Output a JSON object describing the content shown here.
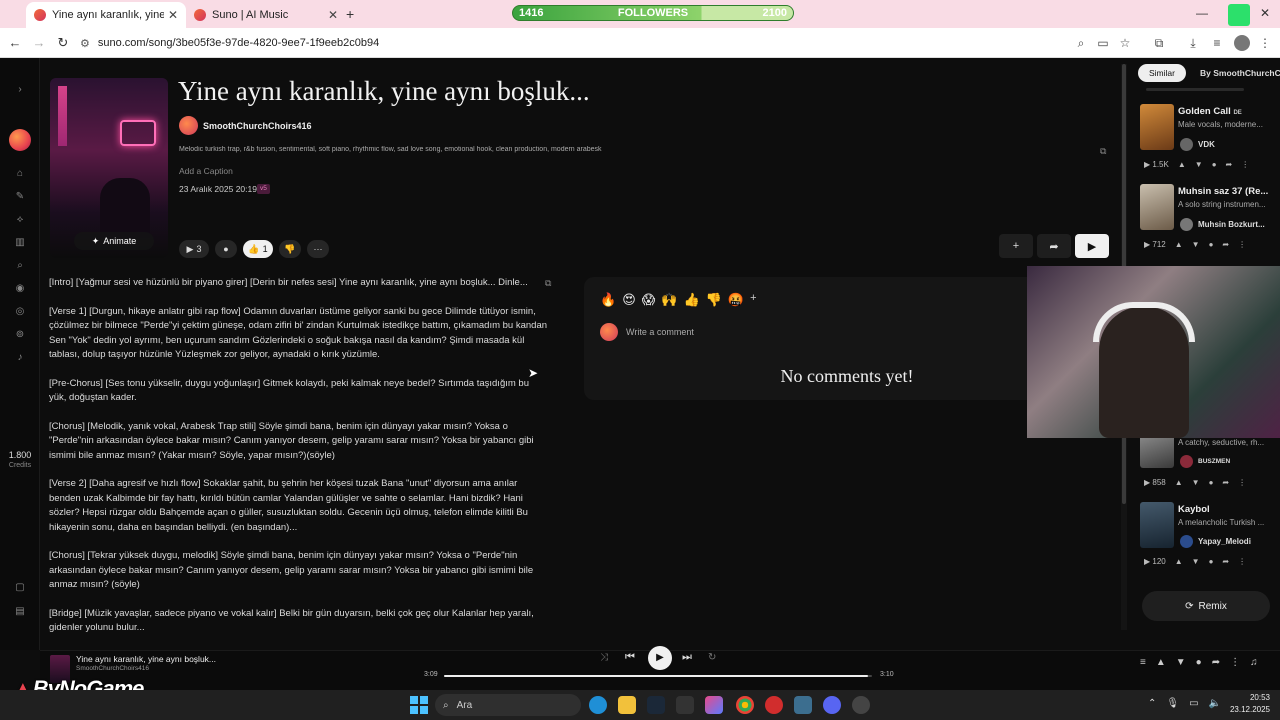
{
  "browser": {
    "tabs": [
      {
        "title": "Yine aynı karanlık, yine aynı boşluk...",
        "close": "✕"
      },
      {
        "title": "Suno | AI Music",
        "close": "✕"
      }
    ],
    "new_tab": "+",
    "url": "suno.com/song/3be05f3e-97de-4820-9ee7-1f9eeb2c0b94",
    "followers_overlay": {
      "current": "1416",
      "label": "FOLLOWERS",
      "goal": "2100",
      "progress": 0.674
    }
  },
  "song": {
    "title": "Yine aynı karanlık, yine aynı boşluk...",
    "artist": "SmoothChurchChoirs416",
    "tags": "Melodic turkish trap, r&b fusion, sentimental, soft piano, rhythmic flow, sad love song, emotional hook, clean production, modern arabesk",
    "caption_placeholder": "Add a Caption",
    "date": "23 Aralık 2025 20:19",
    "version": "v5",
    "animate_label": "Animate",
    "plays": "3",
    "likes": "1",
    "lyrics": [
      "[Intro] [Yağmur sesi ve hüzünlü bir piyano girer] [Derin bir nefes sesi] Yine aynı karanlık, yine aynı boşluk... Dinle...",
      "[Verse 1] [Durgun, hikaye anlatır gibi rap flow] Odamın duvarları üstüme geliyor sanki bu gece Dilimde tütüyor ismin, çözülmez bir bilmece \"Perde\"yi çektim güneşe, odam zifiri bi' zindan Kurtulmak istedikçe battım, çıkamadım bu kandan Sen \"Yok\" dedin yol ayrımı, ben uçurum sandım Gözlerindeki o soğuk bakışa nasıl da kandım? Şimdi masada kül tablası, dolup taşıyor hüzünle Yüzleşmek zor geliyor, aynadaki o kırık yüzümle.",
      "[Pre-Chorus] [Ses tonu yükselir, duygu yoğunlaşır] Gitmek kolaydı, peki kalmak neye bedel? Sırtımda taşıdığım bu yük, doğuştan kader.",
      "[Chorus] [Melodik, yanık vokal, Arabesk Trap stili] Söyle şimdi bana, benim için dünyayı yakar mısın? Yoksa o \"Perde\"nin arkasından öylece bakar mısın? Canım yanıyor desem, gelip yaramı sarar mısın? Yoksa bir yabancı gibi ismimi bile anmaz mısın? (Yakar mısın? Söyle, yapar mısın?)(söyle)",
      "[Verse 2] [Daha agresif ve hızlı flow] Sokaklar şahit, bu şehrin her köşesi tuzak Bana \"unut\" diyorsun ama anılar benden uzak Kalbimde bir fay hattı, kırıldı bütün camlar Yalandan gülüşler ve sahte o selamlar. Hani bizdik? Hani sözler? Hepsi rüzgar oldu Bahçemde açan o güller, susuzluktan soldu. Gecenin üçü olmuş, telefon elimde kilitli Bu hikayenin sonu, daha en başından belliydi. (en başından)...",
      "[Chorus] [Tekrar yüksek duygu, melodik] Söyle şimdi bana, benim için dünyayı yakar mısın? Yoksa o \"Perde\"nin arkasından öylece bakar mısın? Canım yanıyor desem, gelip yaramı sarar mısın? Yoksa bir yabancı gibi ismimi bile anmaz mısın? (söyle)",
      "[Bridge] [Müzik yavaşlar, sadece piyano ve vokal kalır] Belki bir gün duyarsın, belki çok geç olur Kalanlar hep yaralı, gidenler yolunu bulur..."
    ]
  },
  "comments": {
    "emoji_reactions": [
      "🔥",
      "😍",
      "😱",
      "🙌",
      "👍",
      "👎",
      "🤬"
    ],
    "add_reaction": "+",
    "placeholder": "Write a comment",
    "empty_text": "No comments yet!"
  },
  "sidebar": {
    "credits": "1.800",
    "credits_label": "Credits"
  },
  "right_panel": {
    "tabs": [
      "Similar",
      "By SmoothChurchCho"
    ],
    "items": [
      {
        "title": "Golden Call",
        "suffix": "DE",
        "desc": "Male vocals, moderne...",
        "user": "VDK",
        "plays": "1.5K"
      },
      {
        "title": "Muhsin saz 37 (Re...",
        "desc": "A solo string instrumen...",
        "user": "Muhsin Bozkurt...",
        "plays": "712"
      },
      {
        "title": "",
        "desc": "A catchy, seductive, rh...",
        "user": "BUSZMEN",
        "plays": "858"
      },
      {
        "title": "Kaybol",
        "desc": "A melancholic Turkish ...",
        "user": "Yapay_Melodi",
        "plays": "120"
      }
    ],
    "remix_label": "Remix"
  },
  "player": {
    "title": "Yine aynı karanlık, yine aynı boşluk...",
    "artist": "SmoothChurchChoirs416",
    "elapsed": "3:09",
    "duration": "3:10",
    "progress": 0.99
  },
  "taskbar": {
    "search_placeholder": "Ara",
    "time": "20:53",
    "date": "23.12.2025"
  },
  "watermark": "ByNoGame",
  "colors": {
    "accent": "#e8434f",
    "bg": "#0d0d0d",
    "tab_strip": "#f9dce5"
  }
}
